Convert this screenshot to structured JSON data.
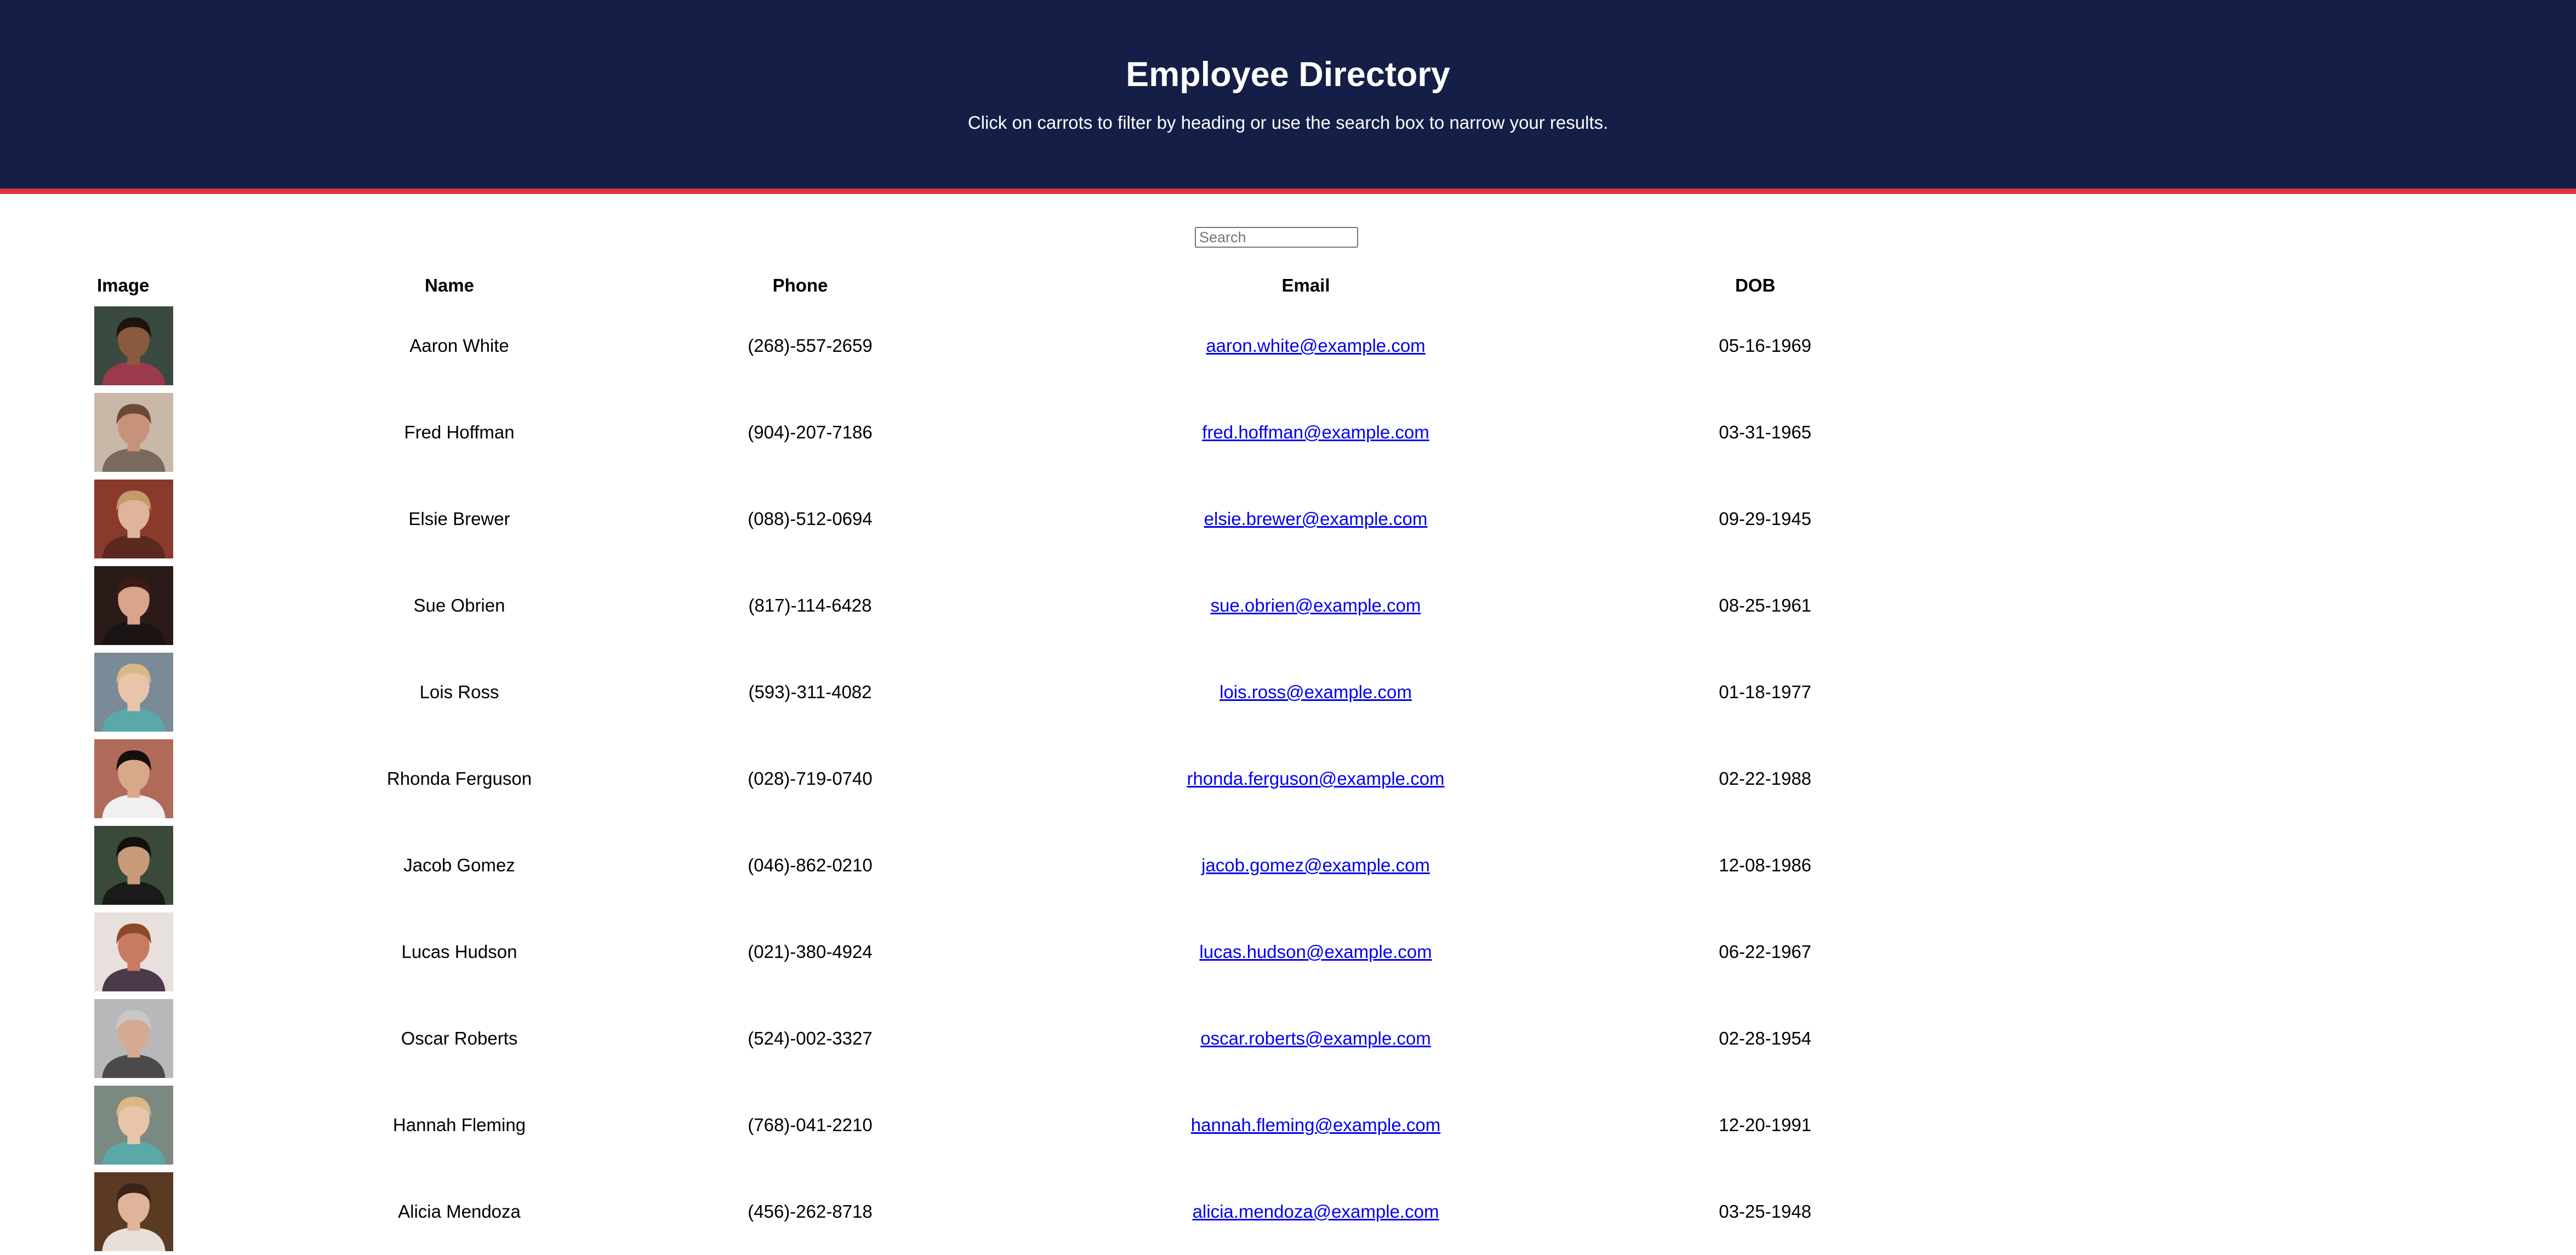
{
  "header": {
    "title": "Employee Directory",
    "subtitle": "Click on carrots to filter by heading or use the search box to narrow your results."
  },
  "search": {
    "placeholder": "Search",
    "value": ""
  },
  "colors": {
    "header_bg": "#141e46",
    "header_border": "#d93842",
    "link": "#0000ee"
  },
  "table": {
    "columns": [
      "Image",
      "Name",
      "Phone",
      "Email",
      "DOB"
    ],
    "rows": [
      {
        "name": "Aaron White",
        "phone": "(268)-557-2659",
        "email": "aaron.white@example.com",
        "dob": "05-16-1969",
        "avatar": {
          "bg": "#3a4a40",
          "skin": "#8a5a3e",
          "hair": "#1c1410",
          "shirt": "#9a3a4a"
        }
      },
      {
        "name": "Fred Hoffman",
        "phone": "(904)-207-7186",
        "email": "fred.hoffman@example.com",
        "dob": "03-31-1965",
        "avatar": {
          "bg": "#c9b8a8",
          "skin": "#c8927a",
          "hair": "#6a4a34",
          "shirt": "#7a6a5e"
        }
      },
      {
        "name": "Elsie Brewer",
        "phone": "(088)-512-0694",
        "email": "elsie.brewer@example.com",
        "dob": "09-29-1945",
        "avatar": {
          "bg": "#8a3a2a",
          "skin": "#e0b49a",
          "hair": "#c49a6a",
          "shirt": "#5a2a22"
        }
      },
      {
        "name": "Sue Obrien",
        "phone": "(817)-114-6428",
        "email": "sue.obrien@example.com",
        "dob": "08-25-1961",
        "avatar": {
          "bg": "#2a1a18",
          "skin": "#d8a48a",
          "hair": "#3a1c14",
          "shirt": "#1a1414"
        }
      },
      {
        "name": "Lois Ross",
        "phone": "(593)-311-4082",
        "email": "lois.ross@example.com",
        "dob": "01-18-1977",
        "avatar": {
          "bg": "#7a8a96",
          "skin": "#eac4aa",
          "hair": "#d8b888",
          "shirt": "#5aa8a8"
        }
      },
      {
        "name": "Rhonda Ferguson",
        "phone": "(028)-719-0740",
        "email": "rhonda.ferguson@example.com",
        "dob": "02-22-1988",
        "avatar": {
          "bg": "#b06a5a",
          "skin": "#d8a88a",
          "hair": "#141010",
          "shirt": "#f0f0f0"
        }
      },
      {
        "name": "Jacob Gomez",
        "phone": "(046)-862-0210",
        "email": "jacob.gomez@example.com",
        "dob": "12-08-1986",
        "avatar": {
          "bg": "#3a4a3a",
          "skin": "#c89a7a",
          "hair": "#141010",
          "shirt": "#1a1a1a"
        }
      },
      {
        "name": "Lucas Hudson",
        "phone": "(021)-380-4924",
        "email": "lucas.hudson@example.com",
        "dob": "06-22-1967",
        "avatar": {
          "bg": "#e8e0dc",
          "skin": "#c87a62",
          "hair": "#8a4a2a",
          "shirt": "#4a3a4a"
        }
      },
      {
        "name": "Oscar Roberts",
        "phone": "(524)-002-3327",
        "email": "oscar.roberts@example.com",
        "dob": "02-28-1954",
        "avatar": {
          "bg": "#b8b8b8",
          "skin": "#d4aa92",
          "hair": "#c8c8c8",
          "shirt": "#4a4a4a"
        }
      },
      {
        "name": "Hannah Fleming",
        "phone": "(768)-041-2210",
        "email": "hannah.fleming@example.com",
        "dob": "12-20-1991",
        "avatar": {
          "bg": "#7a8a80",
          "skin": "#eac4aa",
          "hair": "#d8b888",
          "shirt": "#5aa8a8"
        }
      },
      {
        "name": "Alicia Mendoza",
        "phone": "(456)-262-8718",
        "email": "alicia.mendoza@example.com",
        "dob": "03-25-1948",
        "avatar": {
          "bg": "#5a3a22",
          "skin": "#e0b49a",
          "hair": "#3a241a",
          "shirt": "#e8e0d8"
        }
      }
    ]
  }
}
